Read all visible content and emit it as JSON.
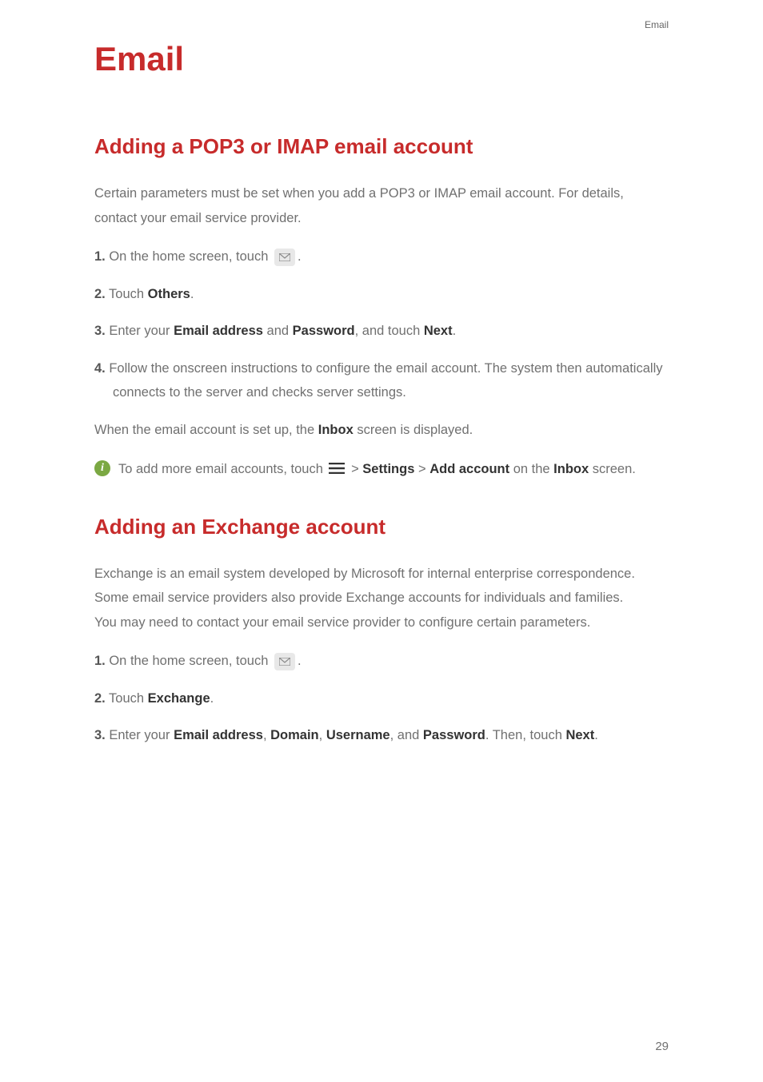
{
  "header": {
    "label": "Email"
  },
  "title": "Email",
  "section1": {
    "heading": "Adding a POP3 or IMAP email account",
    "intro": "Certain parameters must be set when you add a POP3 or IMAP email account. For details, contact your email service provider.",
    "step1_prefix": "1.",
    "step1_text": " On the home screen, touch ",
    "step1_suffix": ".",
    "step2_prefix": "2.",
    "step2_text": " Touch ",
    "step2_bold": "Others",
    "step2_suffix": ".",
    "step3_prefix": "3.",
    "step3_a": " Enter your ",
    "step3_b1": "Email address",
    "step3_c": " and ",
    "step3_b2": "Password",
    "step3_d": ", and touch ",
    "step3_b3": "Next",
    "step3_e": ".",
    "step4_prefix": "4.",
    "step4_text": " Follow the onscreen instructions to configure the email account. The system then automatically connects to the server and checks server settings.",
    "outro_a": "When the email account is set up, the ",
    "outro_b": "Inbox",
    "outro_c": " screen is displayed.",
    "note_a": "To add more email accounts, touch ",
    "note_b": " > ",
    "note_c": "Settings",
    "note_d": " > ",
    "note_e": "Add account",
    "note_f": " on the ",
    "note_g": "Inbox",
    "note_h": " screen."
  },
  "section2": {
    "heading": "Adding an Exchange account",
    "intro1": "Exchange is an email system developed by Microsoft for internal enterprise correspondence. Some email service providers also provide Exchange accounts for individuals and families.",
    "intro2": "You may need to contact your email service provider to configure certain parameters.",
    "step1_prefix": "1.",
    "step1_text": " On the home screen, touch ",
    "step1_suffix": ".",
    "step2_prefix": "2.",
    "step2_text": " Touch ",
    "step2_bold": "Exchange",
    "step2_suffix": ".",
    "step3_prefix": "3.",
    "step3_a": " Enter your ",
    "step3_b1": "Email address",
    "step3_c": ", ",
    "step3_b2": "Domain",
    "step3_d": ", ",
    "step3_b3": "Username",
    "step3_e": ", and ",
    "step3_b4": "Password",
    "step3_f": ". Then, touch ",
    "step3_b5": "Next",
    "step3_g": "."
  },
  "pageNumber": "29",
  "icons": {
    "email": "email-icon",
    "menu": "menu-icon",
    "info": "info-icon"
  }
}
